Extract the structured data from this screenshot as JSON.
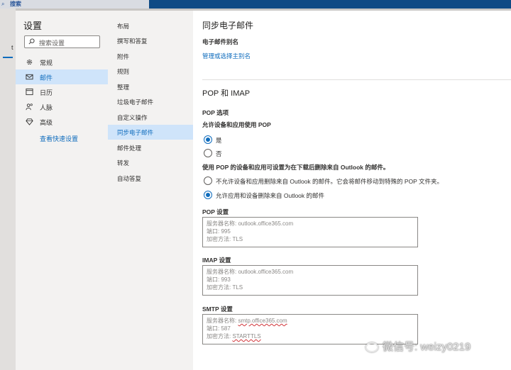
{
  "topbar": {
    "search_label": "搜索"
  },
  "background_app": {
    "tab_fragment": "t"
  },
  "settings": {
    "title": "设置",
    "search_placeholder": "搜索设置",
    "categories": [
      {
        "label": "常规",
        "icon": "gear-icon",
        "selected": false
      },
      {
        "label": "邮件",
        "icon": "mail-icon",
        "selected": true
      },
      {
        "label": "日历",
        "icon": "calendar-icon",
        "selected": false
      },
      {
        "label": "人脉",
        "icon": "people-icon",
        "selected": false
      },
      {
        "label": "高级",
        "icon": "diamond-icon",
        "selected": false
      }
    ],
    "quick_settings_link": "查看快速设置"
  },
  "mail_subnav": {
    "items": [
      {
        "label": "布局",
        "selected": false
      },
      {
        "label": "撰写和答复",
        "selected": false
      },
      {
        "label": "附件",
        "selected": false
      },
      {
        "label": "规则",
        "selected": false
      },
      {
        "label": "整理",
        "selected": false
      },
      {
        "label": "垃圾电子邮件",
        "selected": false
      },
      {
        "label": "自定义操作",
        "selected": false
      },
      {
        "label": "同步电子邮件",
        "selected": true
      },
      {
        "label": "邮件处理",
        "selected": false
      },
      {
        "label": "转发",
        "selected": false
      },
      {
        "label": "自动答复",
        "selected": false
      }
    ]
  },
  "sync": {
    "title": "同步电子邮件",
    "alias_label": "电子邮件别名",
    "alias_link": "管理或选择主别名",
    "pop_imap_title": "POP 和 IMAP",
    "pop_options_label": "POP 选项",
    "allow_pop_label": "允许设备和应用使用 POP",
    "allow_yes": "是",
    "allow_no": "否",
    "allow_selected": "yes",
    "delete_label": "使用 POP 的设备和应用可设置为在下载后删除来自 Outlook 的邮件。",
    "delete_option_1": "不允许设备和应用删除来自 Outlook 的邮件。它会将邮件移动到特殊的 POP 文件夹。",
    "delete_option_2": "允许应用和设备删除来自 Outlook 的邮件",
    "delete_selected": 2,
    "pop_settings": {
      "label": "POP 设置",
      "server": "服务器名称: outlook.office365.com",
      "port": "端口: 995",
      "encryption": "加密方法: TLS"
    },
    "imap_settings": {
      "label": "IMAP 设置",
      "server": "服务器名称: outlook.office365.com",
      "port": "端口: 993",
      "encryption": "加密方法: TLS"
    },
    "smtp_settings": {
      "label": "SMTP 设置",
      "server_prefix": "服务器名称: ",
      "server_value": "smtp.office365.com",
      "port": "端口: 587",
      "encryption_prefix": "加密方法: ",
      "encryption_value": "STARTTLS"
    }
  },
  "watermark": {
    "text": "微信号: weizy0219"
  },
  "colors": {
    "accent": "#0f6cbd",
    "selected_bg": "#cfe4fa",
    "nav_bg": "#f3f2f1",
    "header": "#0f4a85"
  }
}
